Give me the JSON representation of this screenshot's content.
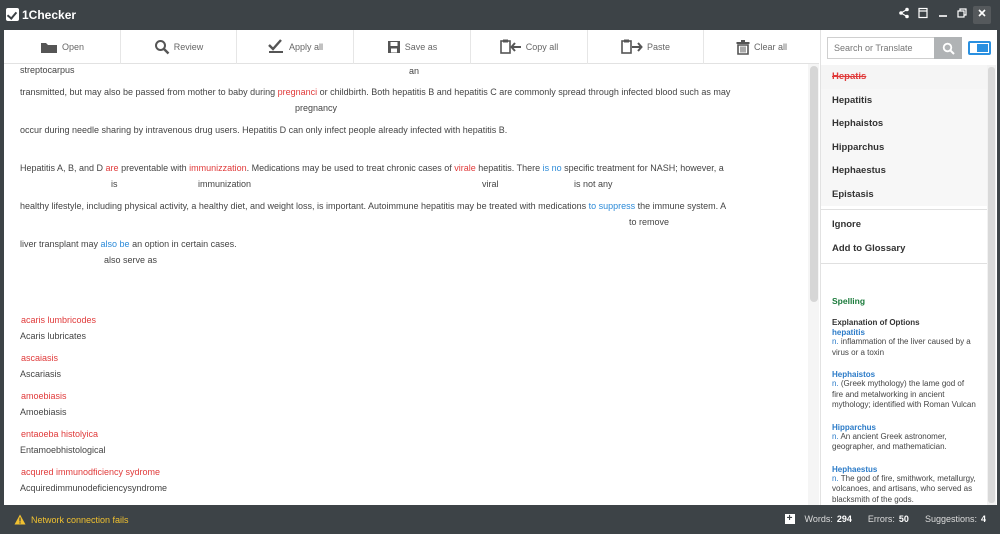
{
  "app": {
    "title": "1Checker"
  },
  "toolbar": {
    "open": "Open",
    "review": "Review",
    "apply_all": "Apply all",
    "save_as": "Save as",
    "copy_all": "Copy all",
    "paste": "Paste",
    "clear_all": "Clear all"
  },
  "editor": {
    "l1": "streptocarpus",
    "l1_sug": "an",
    "l2a": "transmitted, but may also be passed from mother to baby during ",
    "l2_err": "pregnanci",
    "l2b": " or childbirth. Both hepatitis B and hepatitis C are commonly spread through infected blood such as may",
    "l2_sug": "pregnancy",
    "l3": "occur during needle sharing by intravenous drug users. Hepatitis D can only infect people already infected with hepatitis B.",
    "l4a": "Hepatitis A, B, and D ",
    "l4_err1": "are",
    "l4b": " preventable with ",
    "l4_err2": "immunizzation",
    "l4c": ". Medications may be used to treat chronic cases of ",
    "l4_err3": "virale",
    "l4d": " hepatitis. There ",
    "l4_err4": "is no",
    "l4e": " specific treatment for NASH; however, a",
    "l4_sug1": "is",
    "l4_sug2": "immunization",
    "l4_sug3": "viral",
    "l4_sug4": "is not any",
    "l5a": "healthy lifestyle, including physical activity, a healthy diet, and weight loss, is important. Autoimmune hepatitis may be treated with medications ",
    "l5_err": "to suppress",
    "l5b": " the immune system. A",
    "l5_sug": "to remove",
    "l6a": "liver transplant may ",
    "l6_err": "also be",
    "l6b": " an option in certain cases.",
    "l6_sug": "also serve as",
    "terms": [
      {
        "error": "acaris lumbricodes",
        "fix": "Acaris lubricates"
      },
      {
        "error": "ascaiasis",
        "fix": "Ascariasis"
      },
      {
        "error": "amoebiasis",
        "fix": "Amoebiasis"
      },
      {
        "error": "entaoeba histolyica",
        "fix": "Entamoebhistological"
      },
      {
        "error": "acqured immunodficiency sydrome",
        "fix": "Acquiredimmunodeficiencysyndrome"
      }
    ]
  },
  "panel": {
    "search_placeholder": "Search or Translate",
    "original": "Hepatis",
    "suggestions": [
      "Hepatitis",
      "Hephaistos",
      "Hipparchus",
      "Hephaestus",
      "Epistasis"
    ],
    "ignore": "Ignore",
    "add_glossary": "Add to Glossary",
    "spelling": "Spelling",
    "explain_head": "Explanation of Options",
    "explanations": [
      {
        "word": "hepatitis",
        "pos": "n.",
        "def": " inflammation of the liver caused by a virus or a toxin"
      },
      {
        "word": "Hephaistos",
        "pos": "n.",
        "def": " (Greek mythology) the lame god of fire and metalworking in ancient mythology; identified with Roman Vulcan"
      },
      {
        "word": "Hipparchus",
        "pos": "n.",
        "def": " An ancient Greek astronomer, geographer, and mathematician."
      },
      {
        "word": "Hephaestus",
        "pos": "n.",
        "def": " The god of fire, smithwork, metallurgy, volcanoes, and artisans, who served as blacksmith of the gods."
      }
    ]
  },
  "status": {
    "warning": "Network connection fails",
    "words_label": "Words:",
    "words": "294",
    "errors_label": "Errors:",
    "errors": "50",
    "suggestions_label": "Suggestions:",
    "suggestions": "4"
  },
  "colors": {
    "error": "#e03a3a",
    "blue": "#2b8ad8",
    "chrome": "#3d4347",
    "toggle": "#2a90e0"
  }
}
